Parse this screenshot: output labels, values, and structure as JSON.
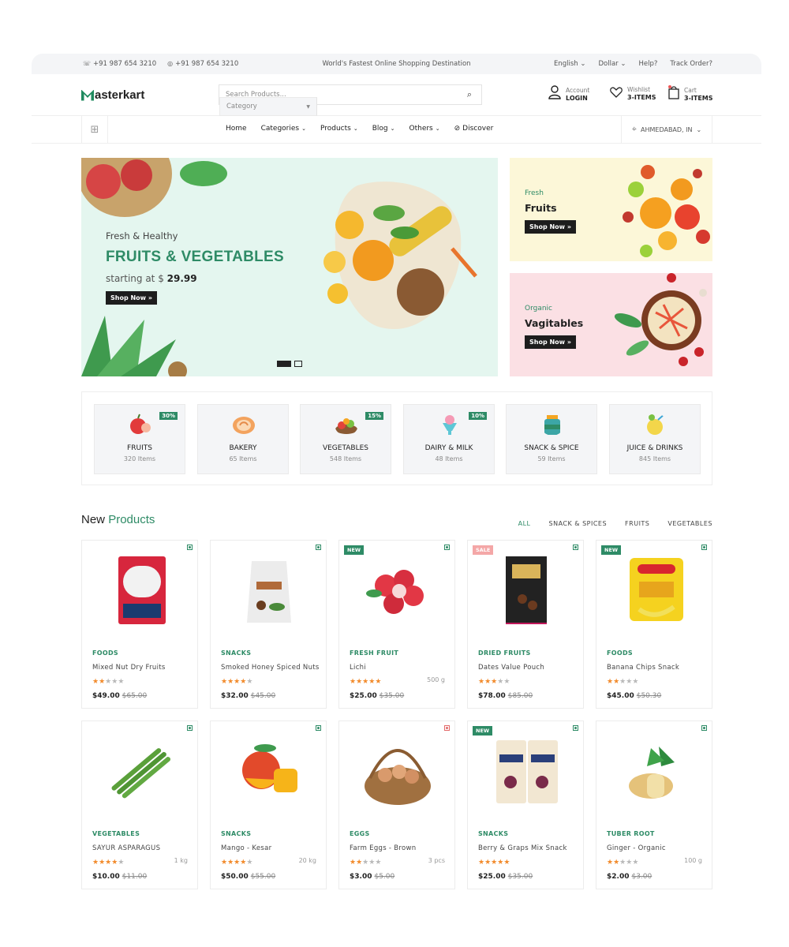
{
  "topbar": {
    "phone1": "+91 987 654 3210",
    "phone2": "+91 987 654 3210",
    "tagline": "World's Fastest Online Shopping Destination",
    "language": "English",
    "currency": "Dollar",
    "help": "Help?",
    "track": "Track Order?"
  },
  "header": {
    "logo": "asterkart",
    "category_select": "Category",
    "search_placeholder": "Search Products...",
    "account_label": "Account",
    "account_value": "LOGIN",
    "wishlist_label": "Wishlist",
    "wishlist_value": "3-ITEMS",
    "cart_label": "Cart",
    "cart_value": "3-ITEMS"
  },
  "nav": {
    "items": [
      "Home",
      "Categories",
      "Products",
      "Blog",
      "Others",
      "Discover"
    ],
    "location": "AHMEDABAD, IN"
  },
  "hero": {
    "subtitle": "Fresh & Healthy",
    "title": "FRUITS & VEGETABLES",
    "price_prefix": "starting at $",
    "price": "29.99",
    "button": "Shop Now »"
  },
  "side_banners": [
    {
      "small": "Fresh",
      "title": "Fruits",
      "button": "Shop Now »"
    },
    {
      "small": "Organic",
      "title": "Vagitables",
      "button": "Shop Now »"
    }
  ],
  "categories": [
    {
      "name": "FRUITS",
      "count": "320 Items",
      "badge": "30%",
      "icon": "apple-icon"
    },
    {
      "name": "BAKERY",
      "count": "65 Items",
      "badge": "",
      "icon": "bread-icon"
    },
    {
      "name": "VEGETABLES",
      "count": "548 Items",
      "badge": "15%",
      "icon": "vegetables-icon"
    },
    {
      "name": "DAIRY & MILK",
      "count": "48 Items",
      "badge": "10%",
      "icon": "ice-cream-icon"
    },
    {
      "name": "SNACK & SPICE",
      "count": "59 Items",
      "badge": "",
      "icon": "jar-icon"
    },
    {
      "name": "JUICE & DRINKS",
      "count": "845 Items",
      "badge": "",
      "icon": "juice-icon"
    }
  ],
  "new_products": {
    "title_a": "New",
    "title_b": "Products",
    "filters": [
      "ALL",
      "SNACK & SPICES",
      "FRUITS",
      "VEGETABLES"
    ],
    "items": [
      {
        "category": "FOODS",
        "name": "Mixed Nut Dry Fruits",
        "rating": 2,
        "price": "$49.00",
        "old": "$65.00",
        "weight": "",
        "tag": ""
      },
      {
        "category": "SNACKS",
        "name": "Smoked Honey Spiced Nuts",
        "rating": 4,
        "price": "$32.00",
        "old": "$45.00",
        "weight": "",
        "tag": ""
      },
      {
        "category": "FRESH FRUIT",
        "name": "Lichi",
        "rating": 5,
        "price": "$25.00",
        "old": "$35.00",
        "weight": "500 g",
        "tag": "NEW"
      },
      {
        "category": "DRIED FRUITS",
        "name": "Dates Value Pouch",
        "rating": 3,
        "price": "$78.00",
        "old": "$85.00",
        "weight": "",
        "tag": "SALE"
      },
      {
        "category": "FOODS",
        "name": "Banana Chips Snack",
        "rating": 2,
        "price": "$45.00",
        "old": "$50.30",
        "weight": "",
        "tag": "NEW"
      },
      {
        "category": "VEGETABLES",
        "name": "SAYUR ASPARAGUS",
        "rating": 4,
        "price": "$10.00",
        "old": "$11.00",
        "weight": "1 kg",
        "tag": ""
      },
      {
        "category": "SNACKS",
        "name": "Mango - Kesar",
        "rating": 4,
        "price": "$50.00",
        "old": "$55.00",
        "weight": "20 kg",
        "tag": ""
      },
      {
        "category": "EGGS",
        "name": "Farm Eggs - Brown",
        "rating": 2,
        "price": "$3.00",
        "old": "$5.00",
        "weight": "3 pcs",
        "tag": ""
      },
      {
        "category": "SNACKS",
        "name": "Berry & Graps Mix Snack",
        "rating": 5,
        "price": "$25.00",
        "old": "$35.00",
        "weight": "",
        "tag": "NEW"
      },
      {
        "category": "TUBER ROOT",
        "name": "Ginger - Organic",
        "rating": 2,
        "price": "$2.00",
        "old": "$3.00",
        "weight": "100 g",
        "tag": ""
      }
    ]
  },
  "colors": {
    "accent": "#2e8b66",
    "sale": "#f4a7a7",
    "star": "#f28b2c"
  }
}
